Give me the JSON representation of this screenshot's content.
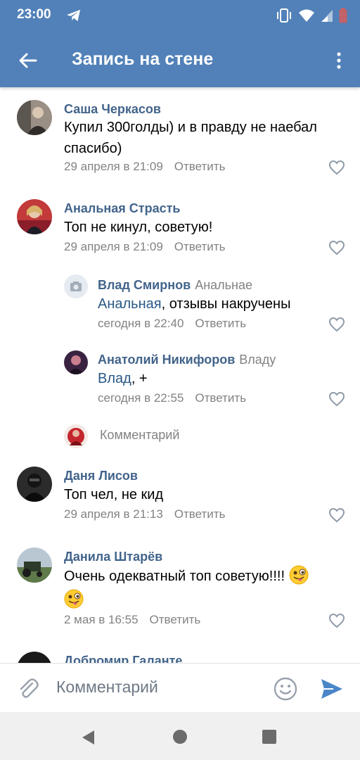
{
  "status_bar": {
    "time": "23:00"
  },
  "toolbar": {
    "title": "Запись на стене"
  },
  "comments": [
    {
      "author": "Саша Черкасов",
      "text_line1": "Купил 300голды) и в правду не наебал",
      "text_line2": "спасибо)",
      "date": "29 апреля в 21:09",
      "reply_label": "Ответить"
    },
    {
      "author": "Анальная Страсть",
      "text_line1": "Топ не кинул, советую!",
      "date": "29 апреля в 21:09",
      "reply_label": "Ответить"
    },
    {
      "author": "Даня Лисов",
      "text_line1": "Топ чел, не кид",
      "date": "29 апреля в 21:13",
      "reply_label": "Ответить"
    },
    {
      "author": "Данила Штарёв",
      "text_line1": "Очень одекватный топ советую!!!!",
      "date": "2 мая в 16:55",
      "reply_label": "Ответить"
    },
    {
      "author": "Добромир Галанте"
    }
  ],
  "replies": [
    {
      "author": "Влад Смирнов",
      "reply_to": "Анальнае",
      "mention": "Анальная",
      "text_rest": ", отзывы накручены",
      "date": "сегодня в 22:40",
      "reply_label": "Ответить"
    },
    {
      "author": "Анатолий Никифоров",
      "reply_to": "Владу",
      "mention": "Влад",
      "text_rest": ", +",
      "date": "сегодня в 22:55",
      "reply_label": "Ответить"
    }
  ],
  "reply_input": {
    "placeholder": "Комментарий"
  },
  "composer": {
    "placeholder": "Комментарий"
  },
  "colors": {
    "header": "#5181b8",
    "author": "#42648b",
    "meta": "#828282",
    "send": "#4a86c8"
  }
}
